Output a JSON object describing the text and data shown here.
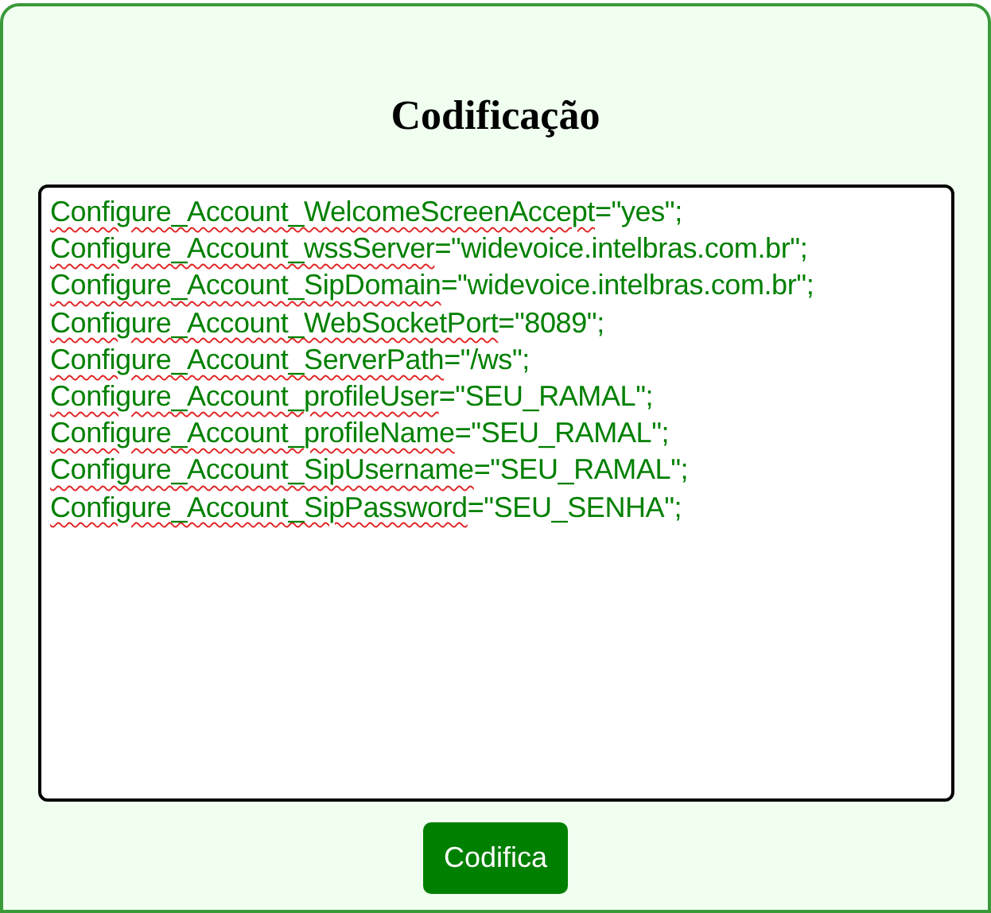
{
  "title": "Codificação",
  "editor": {
    "lines": [
      {
        "name": "Configure_Account_WelcomeScreenAccept",
        "rest": "=\"yes\";",
        "misspelled": true
      },
      {
        "name": "Configure_Account_wssServer",
        "rest": "=\"widevoice.intelbras.com.br\";",
        "misspelled": true
      },
      {
        "name": "Configure_Account_SipDomain",
        "rest": "=\"widevoice.intelbras.com.br\";",
        "misspelled": true
      },
      {
        "name": "Configure_Account_WebSocketPort",
        "rest": "=\"8089\";",
        "misspelled": true
      },
      {
        "name": "Configure_Account_ServerPath",
        "rest": "=\"/ws\";",
        "misspelled": true
      },
      {
        "name": "Configure_Account_profileUser",
        "rest": "=\"SEU_RAMAL\";",
        "misspelled": true
      },
      {
        "name": "Configure_Account_profileName",
        "rest": "=\"SEU_RAMAL\";",
        "misspelled": true
      },
      {
        "name": "Configure_Account_SipUsername",
        "rest": "=\"SEU_RAMAL\";",
        "misspelled": true
      },
      {
        "name": "Configure_Account_SipPassword",
        "rest": "=\"SEU_SENHA\";",
        "misspelled": true
      }
    ]
  },
  "button": "Codifica"
}
